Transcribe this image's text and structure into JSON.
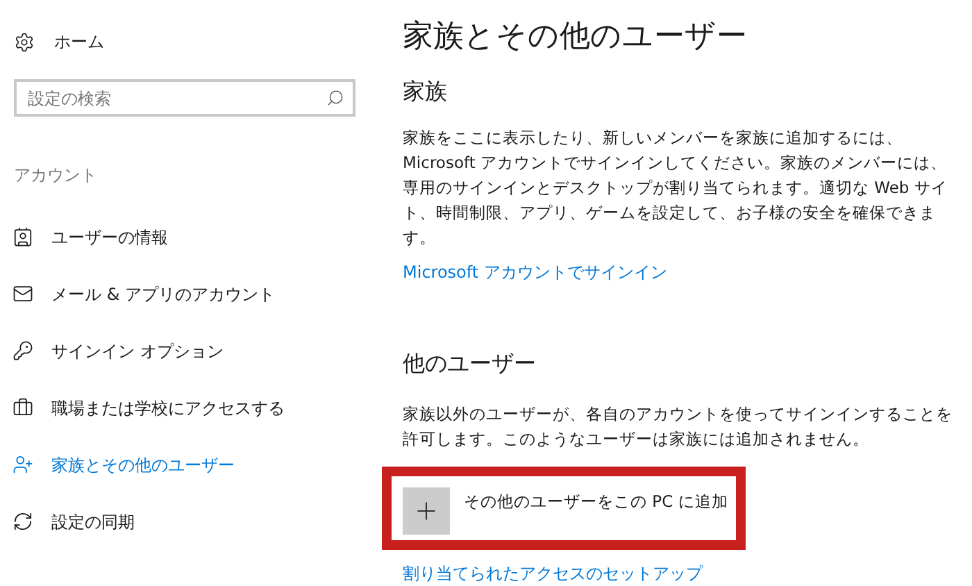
{
  "sidebar": {
    "home": "ホーム",
    "search": {
      "placeholder": "設定の検索"
    },
    "section": "アカウント",
    "items": [
      {
        "label": "ユーザーの情報",
        "kind": "user-info",
        "selected": false
      },
      {
        "label": "メール & アプリのアカウント",
        "kind": "mail",
        "selected": false
      },
      {
        "label": "サインイン オプション",
        "kind": "key",
        "selected": false
      },
      {
        "label": "職場または学校にアクセスする",
        "kind": "work",
        "selected": false
      },
      {
        "label": "家族とその他のユーザー",
        "kind": "family",
        "selected": true
      },
      {
        "label": "設定の同期",
        "kind": "sync",
        "selected": false
      }
    ]
  },
  "page": {
    "title": "家族とその他のユーザー",
    "family": {
      "heading": "家族",
      "text": "家族をここに表示したり、新しいメンバーを家族に追加するには、Microsoft アカウントでサインインしてください。家族のメンバーには、専用のサインインとデスクトップが割り当てられます。適切な Web サイト、時間制限、アプリ、ゲームを設定して、お子様の安全を確保できます。",
      "link": "Microsoft アカウントでサインイン"
    },
    "others": {
      "heading": "他のユーザー",
      "text": "家族以外のユーザーが、各自のアカウントを使ってサインインすることを許可します。このようなユーザーは家族には追加されません。",
      "add_button": {
        "label": "その他のユーザーをこの PC に追加",
        "highlighted": true
      },
      "link": "割り当てられたアクセスのセットアップ"
    }
  }
}
